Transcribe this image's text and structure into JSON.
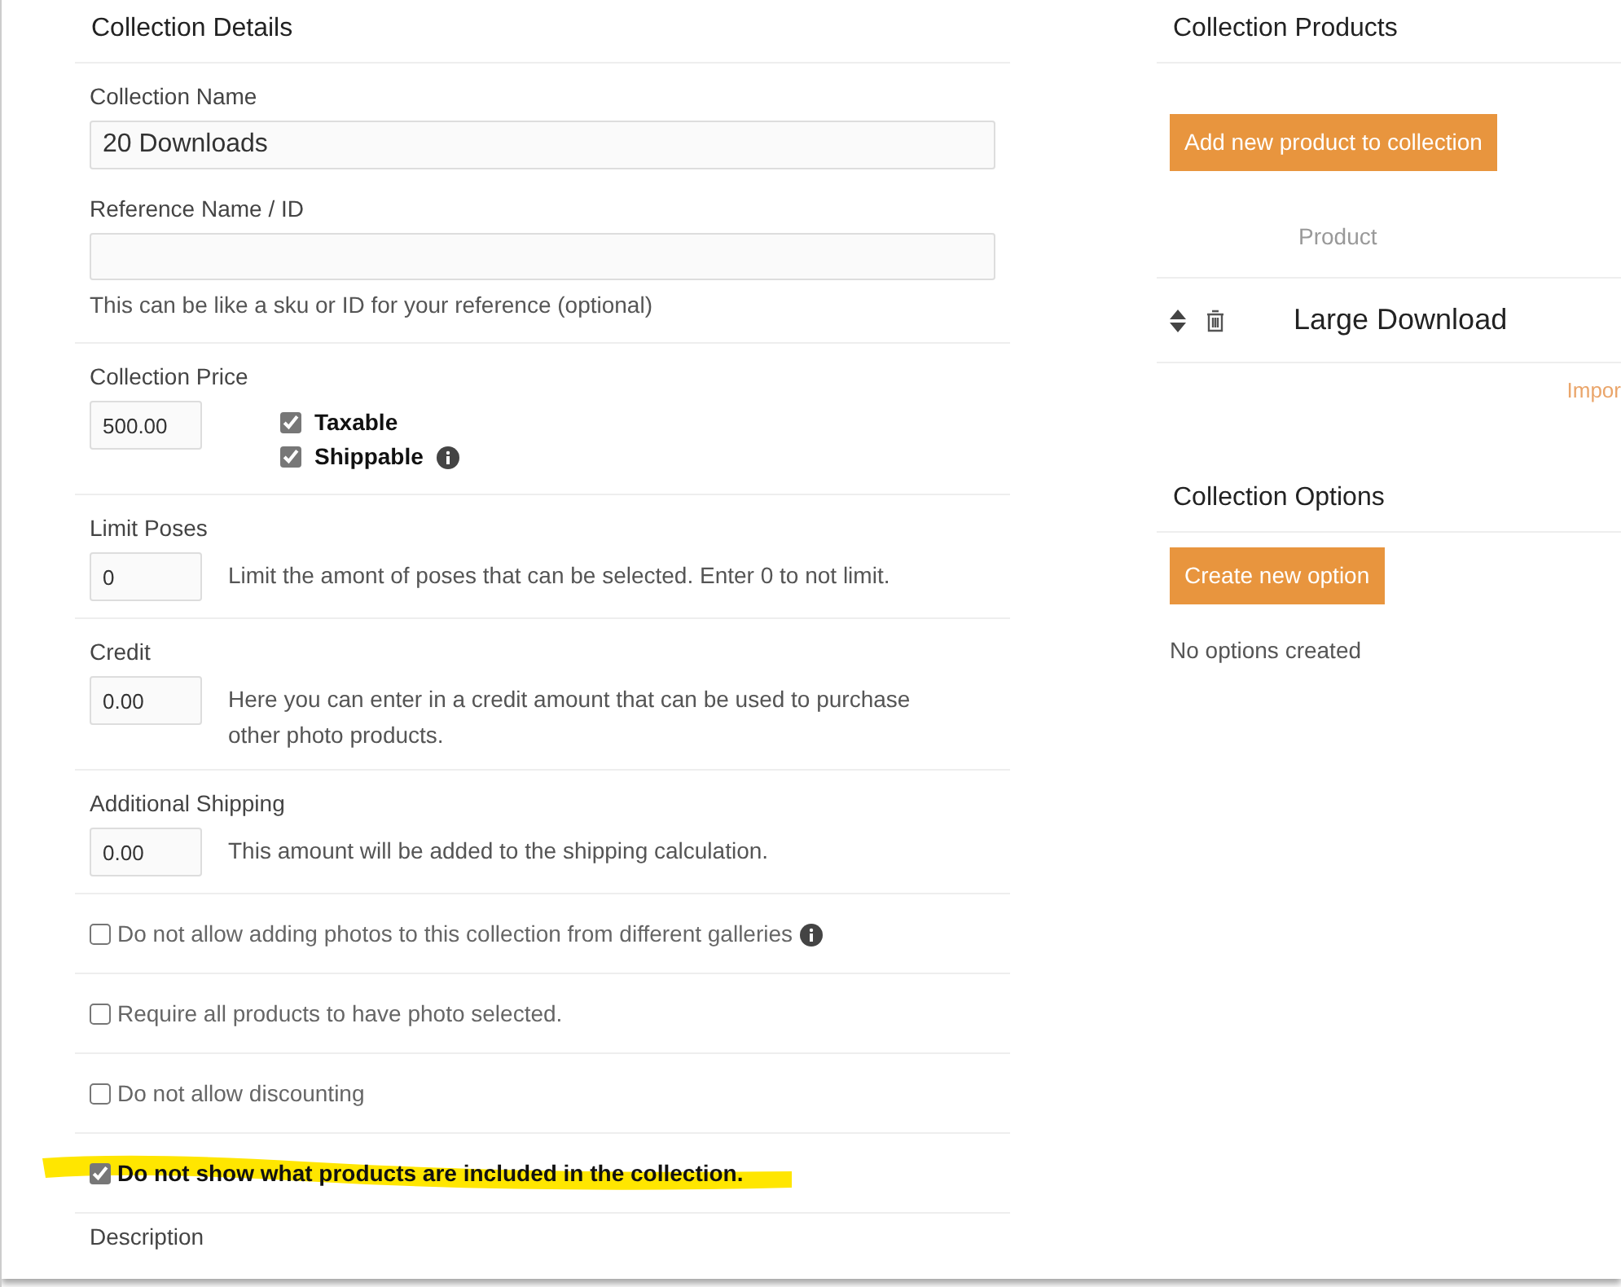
{
  "details": {
    "title": "Collection Details",
    "name_field": {
      "label": "Collection Name",
      "value": "20 Downloads"
    },
    "reference_field": {
      "label": "Reference Name / ID",
      "help": "This can be like a sku or ID for your reference (optional)"
    },
    "price": {
      "label": "Collection Price",
      "value": "500.00",
      "flags": [
        {
          "label": "Taxable",
          "checked": true,
          "info": false
        },
        {
          "label": "Shippable",
          "checked": true,
          "info": true
        }
      ]
    },
    "inline_fields": [
      {
        "label": "Limit Poses",
        "value": "0",
        "help": "Limit the amont of poses that can be selected. Enter 0 to not limit."
      },
      {
        "label": "Credit",
        "value": "0.00",
        "help": "Here you can enter in a credit amount that can be used to purchase other photo products."
      },
      {
        "label": "Additional Shipping",
        "value": "0.00",
        "help": "This amount will be added to the shipping calculation."
      }
    ],
    "options": [
      {
        "label": "Do not allow adding photos to this collection from different galleries",
        "checked": false,
        "info": true,
        "highlighted": false
      },
      {
        "label": "Require all products to have photo selected.",
        "checked": false,
        "info": false,
        "highlighted": false
      },
      {
        "label": "Do not allow discounting",
        "checked": false,
        "info": false,
        "highlighted": false
      },
      {
        "label": "Do not show what products are included in the collection.",
        "checked": true,
        "info": false,
        "highlighted": true
      }
    ],
    "next_label": "Description"
  },
  "products": {
    "title": "Collection Products",
    "add_button": "Add new product to collection",
    "column": "Product",
    "rows": [
      {
        "name": "Large Download"
      }
    ],
    "link": "Impor"
  },
  "collection_options": {
    "title": "Collection Options",
    "create_button": "Create new option",
    "empty": "No options created"
  }
}
